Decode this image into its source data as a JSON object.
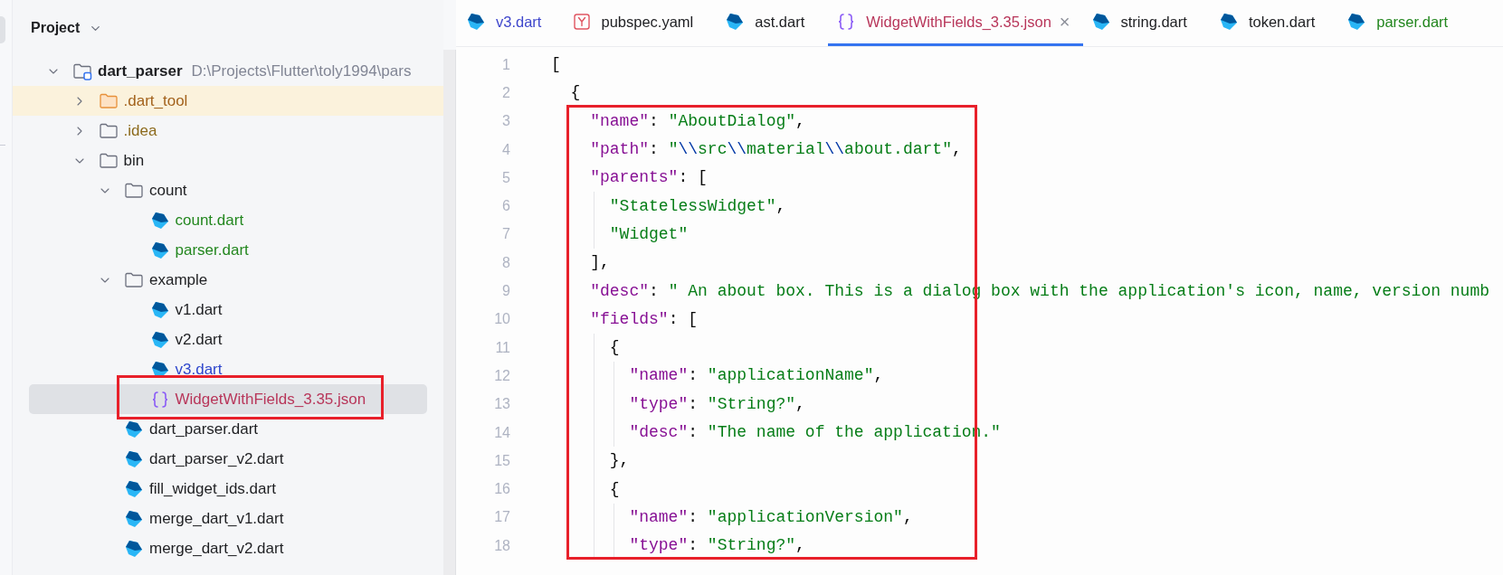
{
  "project_panel": {
    "title": "Project",
    "tree": [
      {
        "label": "dart_parser",
        "kind": "module",
        "hint": "D:\\Projects\\Flutter\\toly1994\\pars",
        "color": "#1e1f22",
        "expanded": true,
        "selected": false,
        "highlighted": false,
        "children": [
          {
            "label": ".dart_tool",
            "kind": "folder",
            "color": "#a3621c",
            "expanded": false,
            "selected": false,
            "highlighted": true
          },
          {
            "label": ".idea",
            "kind": "folder",
            "color": "#8c6a1c",
            "expanded": false,
            "selected": false,
            "highlighted": false
          },
          {
            "label": "bin",
            "kind": "folder",
            "color": "#1e1f22",
            "expanded": true,
            "selected": false,
            "highlighted": false,
            "children": [
              {
                "label": "count",
                "kind": "folder",
                "color": "#1e1f22",
                "expanded": true,
                "selected": false,
                "highlighted": false,
                "children": [
                  {
                    "label": "count.dart",
                    "kind": "dart",
                    "color": "#23871f",
                    "selected": false,
                    "highlighted": false
                  },
                  {
                    "label": "parser.dart",
                    "kind": "dart",
                    "color": "#23871f",
                    "selected": false,
                    "highlighted": false
                  }
                ]
              },
              {
                "label": "example",
                "kind": "folder",
                "color": "#1e1f22",
                "expanded": true,
                "selected": false,
                "highlighted": false,
                "children": [
                  {
                    "label": "v1.dart",
                    "kind": "dart",
                    "color": "#1e1f22",
                    "selected": false,
                    "highlighted": false
                  },
                  {
                    "label": "v2.dart",
                    "kind": "dart",
                    "color": "#1e1f22",
                    "selected": false,
                    "highlighted": false
                  },
                  {
                    "label": "v3.dart",
                    "kind": "dart",
                    "color": "#2f47cc",
                    "selected": false,
                    "highlighted": false
                  },
                  {
                    "label": "WidgetWithFields_3.35.json",
                    "kind": "json",
                    "color": "#b8365a",
                    "selected": true,
                    "highlighted": false,
                    "frame": {
                      "color": "#e8202a"
                    }
                  }
                ]
              },
              {
                "label": "dart_parser.dart",
                "kind": "dart",
                "color": "#1e1f22",
                "selected": false,
                "highlighted": false
              },
              {
                "label": "dart_parser_v2.dart",
                "kind": "dart",
                "color": "#1e1f22",
                "selected": false,
                "highlighted": false
              },
              {
                "label": "fill_widget_ids.dart",
                "kind": "dart",
                "color": "#1e1f22",
                "selected": false,
                "highlighted": false
              },
              {
                "label": "merge_dart_v1.dart",
                "kind": "dart",
                "color": "#1e1f22",
                "selected": false,
                "highlighted": false
              },
              {
                "label": "merge_dart_v2.dart",
                "kind": "dart",
                "color": "#1e1f22",
                "selected": false,
                "highlighted": false
              }
            ]
          }
        ]
      }
    ]
  },
  "editor": {
    "tabs": [
      {
        "label": "v3.dart",
        "kind": "dart",
        "color": "#3f47cc",
        "selected": false
      },
      {
        "label": "pubspec.yaml",
        "kind": "yaml",
        "color": "#1e1f22",
        "selected": false
      },
      {
        "label": "ast.dart",
        "kind": "dart",
        "color": "#1e1f22",
        "selected": false
      },
      {
        "label": "WidgetWithFields_3.35.json",
        "kind": "json",
        "color": "#b8365a",
        "selected": true,
        "close": "×"
      },
      {
        "label": "string.dart",
        "kind": "dart",
        "color": "#1e1f22",
        "selected": false
      },
      {
        "label": "token.dart",
        "kind": "dart",
        "color": "#1e1f22",
        "selected": false
      },
      {
        "label": "parser.dart",
        "kind": "dart",
        "color": "#23871f",
        "selected": false
      }
    ],
    "frame": {
      "color": "#e8202a"
    },
    "lines": [
      {
        "number": "1",
        "tokens": [
          {
            "kind": "punct",
            "text": "["
          }
        ]
      },
      {
        "number": "2",
        "tokens": [
          {
            "kind": "punct",
            "text": "  {"
          }
        ]
      },
      {
        "number": "3",
        "tokens": [
          {
            "kind": "key",
            "text": "    \"name\""
          },
          {
            "kind": "punct",
            "text": ": "
          },
          {
            "kind": "string",
            "text": "\"AboutDialog\""
          },
          {
            "kind": "punct",
            "text": ","
          }
        ]
      },
      {
        "number": "4",
        "tokens": [
          {
            "kind": "key",
            "text": "    \"path\""
          },
          {
            "kind": "punct",
            "text": ": "
          },
          {
            "kind": "string",
            "text": "\""
          },
          {
            "kind": "escape",
            "text": "\\\\"
          },
          {
            "kind": "string",
            "text": "src"
          },
          {
            "kind": "escape",
            "text": "\\\\"
          },
          {
            "kind": "string",
            "text": "material"
          },
          {
            "kind": "escape",
            "text": "\\\\"
          },
          {
            "kind": "string",
            "text": "about.dart\""
          },
          {
            "kind": "punct",
            "text": ","
          }
        ]
      },
      {
        "number": "5",
        "tokens": [
          {
            "kind": "key",
            "text": "    \"parents\""
          },
          {
            "kind": "punct",
            "text": ": ["
          }
        ]
      },
      {
        "number": "6",
        "tokens": [
          {
            "kind": "string",
            "text": "      \"StatelessWidget\""
          },
          {
            "kind": "punct",
            "text": ","
          }
        ]
      },
      {
        "number": "7",
        "tokens": [
          {
            "kind": "string",
            "text": "      \"Widget\""
          }
        ]
      },
      {
        "number": "8",
        "tokens": [
          {
            "kind": "punct",
            "text": "    ],"
          }
        ]
      },
      {
        "number": "9",
        "tokens": [
          {
            "kind": "key",
            "text": "    \"desc\""
          },
          {
            "kind": "punct",
            "text": ": "
          },
          {
            "kind": "string",
            "text": "\" An about box. This is a dialog box with the application's icon, name, version numb"
          }
        ]
      },
      {
        "number": "10",
        "tokens": [
          {
            "kind": "key",
            "text": "    \"fields\""
          },
          {
            "kind": "punct",
            "text": ": ["
          }
        ]
      },
      {
        "number": "11",
        "tokens": [
          {
            "kind": "punct",
            "text": "      {"
          }
        ]
      },
      {
        "number": "12",
        "tokens": [
          {
            "kind": "key",
            "text": "        \"name\""
          },
          {
            "kind": "punct",
            "text": ": "
          },
          {
            "kind": "string",
            "text": "\"applicationName\""
          },
          {
            "kind": "punct",
            "text": ","
          }
        ]
      },
      {
        "number": "13",
        "tokens": [
          {
            "kind": "key",
            "text": "        \"type\""
          },
          {
            "kind": "punct",
            "text": ": "
          },
          {
            "kind": "string",
            "text": "\"String?\""
          },
          {
            "kind": "punct",
            "text": ","
          }
        ]
      },
      {
        "number": "14",
        "tokens": [
          {
            "kind": "key",
            "text": "        \"desc\""
          },
          {
            "kind": "punct",
            "text": ": "
          },
          {
            "kind": "string",
            "text": "\"The name of the application.\""
          }
        ]
      },
      {
        "number": "15",
        "tokens": [
          {
            "kind": "punct",
            "text": "      },"
          }
        ]
      },
      {
        "number": "16",
        "tokens": [
          {
            "kind": "punct",
            "text": "      {"
          }
        ]
      },
      {
        "number": "17",
        "tokens": [
          {
            "kind": "key",
            "text": "        \"name\""
          },
          {
            "kind": "punct",
            "text": ": "
          },
          {
            "kind": "string",
            "text": "\"applicationVersion\""
          },
          {
            "kind": "punct",
            "text": ","
          }
        ]
      },
      {
        "number": "18",
        "tokens": [
          {
            "kind": "key",
            "text": "        \"type\""
          },
          {
            "kind": "punct",
            "text": ": "
          },
          {
            "kind": "string",
            "text": "\"String?\""
          },
          {
            "kind": "punct",
            "text": ","
          }
        ]
      }
    ]
  }
}
